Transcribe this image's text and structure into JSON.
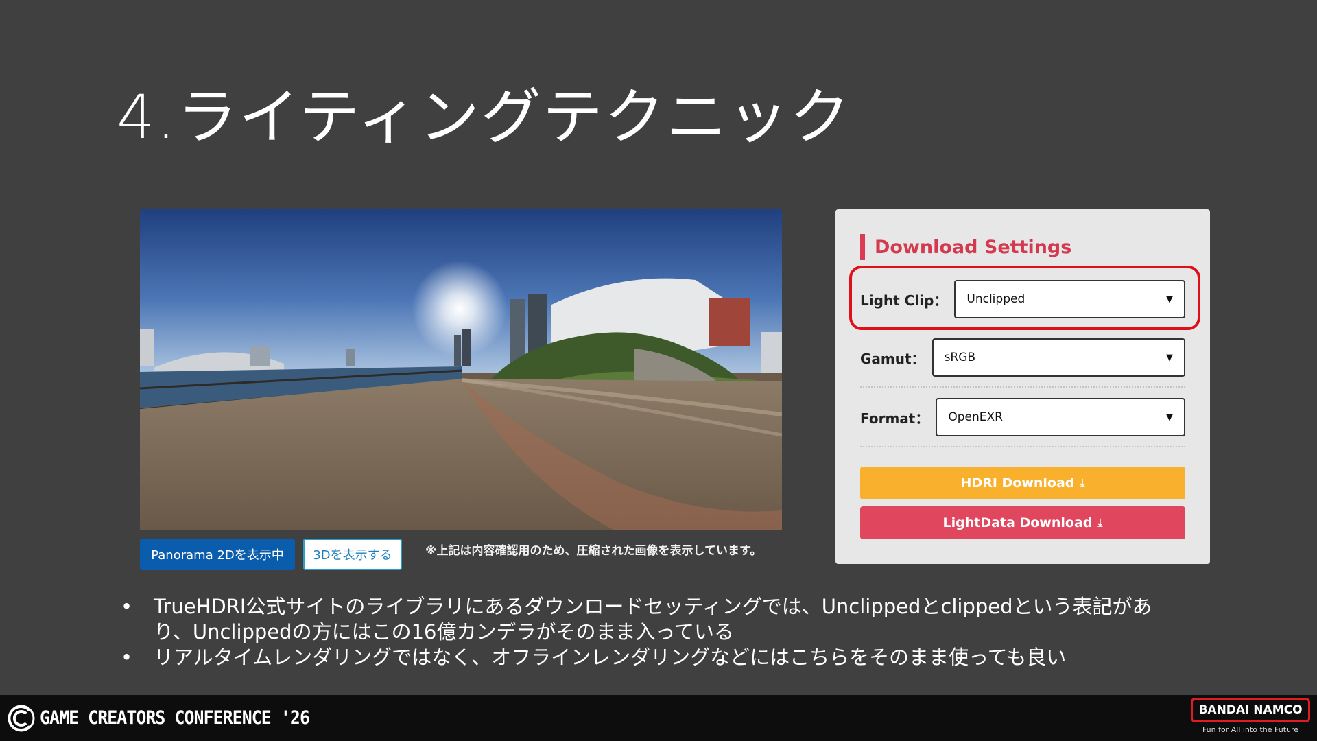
{
  "slide": {
    "title": "4.ライティングテクニック"
  },
  "viewer": {
    "panorama_2d_label": "Panorama 2Dを表示中",
    "view_3d_label": "3Dを表示する",
    "note": "※上記は内容確認用のため、圧縮された画像を表示しています。"
  },
  "download_settings": {
    "heading": "Download Settings",
    "light_clip": {
      "label": "Light Clip：",
      "value": "Unclipped"
    },
    "gamut": {
      "label": "Gamut：",
      "value": "sRGB"
    },
    "format": {
      "label": "Format：",
      "value": "OpenEXR"
    },
    "hdri_download_label": "HDRI Download",
    "lightdata_download_label": "LightData Download",
    "hdri_button_color": "#f9b02c",
    "lightdata_button_color": "#e0475f",
    "highlight_color": "#e0101a"
  },
  "bullets": [
    "TrueHDRI公式サイトのライブラリにあるダウンロードセッティングでは、Unclippedとclippedという表記があり、Unclippedの方にはこの16億カンデラがそのまま入っている",
    "リアルタイムレンダリングではなく、オフラインレンダリングなどにはこちらをそのまま使っても良い"
  ],
  "footer": {
    "conference": "GAME CREATORS CONFERENCE '26",
    "brand": "BANDAI NAMCO",
    "tagline": "Fun for All into the Future"
  }
}
